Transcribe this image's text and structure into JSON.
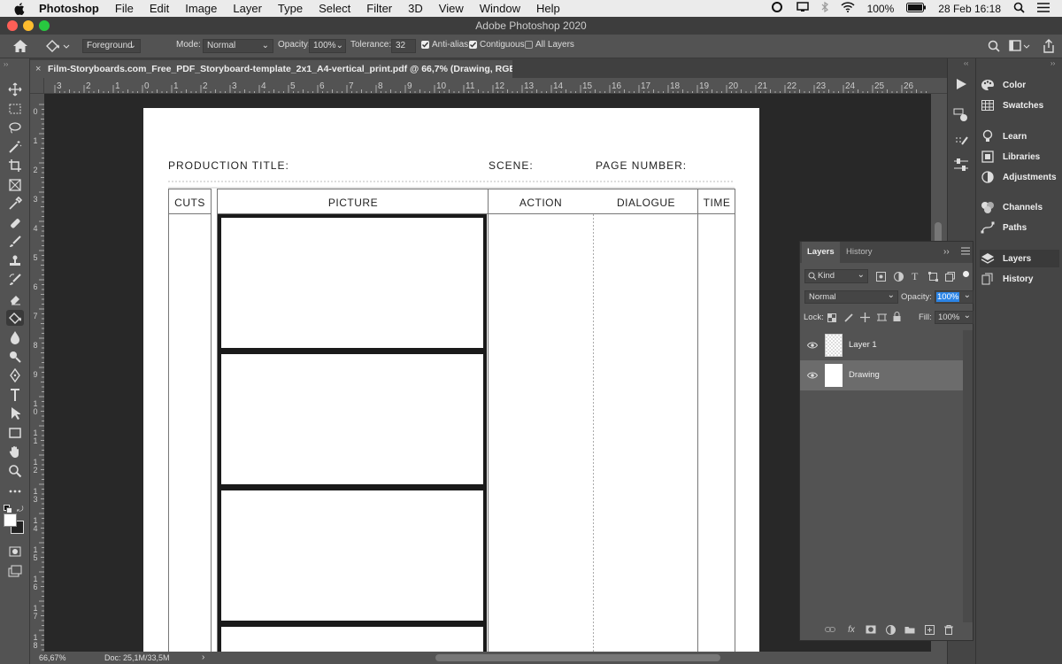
{
  "menubar": {
    "app": "Photoshop",
    "items": [
      "File",
      "Edit",
      "Image",
      "Layer",
      "Type",
      "Select",
      "Filter",
      "3D",
      "View",
      "Window",
      "Help"
    ],
    "battery": "100%",
    "datetime": "28 Feb  16:18"
  },
  "window": {
    "title": "Adobe Photoshop 2020"
  },
  "options": {
    "fill_source": "Foreground",
    "mode_label": "Mode:",
    "mode_value": "Normal",
    "opacity_label": "Opacity:",
    "opacity_value": "100%",
    "tolerance_label": "Tolerance:",
    "tolerance_value": "32",
    "antialias_label": "Anti-alias",
    "contiguous_label": "Contiguous",
    "all_layers_label": "All Layers"
  },
  "document": {
    "tab_title": "Film-Storyboards.com_Free_PDF_Storyboard-template_2x1_A4-vertical_print.pdf @ 66,7% (Drawing, RGB/8) *",
    "zoom": "66,67%",
    "doc_info": "Doc: 25,1M/33,5M"
  },
  "ruler": {
    "h": [
      "3",
      "2",
      "1",
      "0",
      "1",
      "2",
      "3",
      "4",
      "5",
      "6",
      "7",
      "8",
      "9",
      "10",
      "11",
      "12",
      "13",
      "14",
      "15",
      "16",
      "17",
      "18",
      "19",
      "20",
      "21",
      "22",
      "23",
      "24",
      "25",
      "26"
    ],
    "v": [
      "0",
      "1",
      "2",
      "3",
      "4",
      "5",
      "6",
      "7",
      "8",
      "9",
      "10",
      "11",
      "12",
      "13",
      "14",
      "15",
      "16",
      "17",
      "18"
    ]
  },
  "storyboard": {
    "production_title": "PRODUCTION TITLE:",
    "scene": "SCENE:",
    "page_number": "PAGE NUMBER:",
    "cols": [
      "CUTS",
      "PICTURE",
      "ACTION",
      "DIALOGUE",
      "TIME"
    ]
  },
  "panels": {
    "items": [
      "Color",
      "Swatches",
      "Learn",
      "Libraries",
      "Adjustments",
      "Channels",
      "Paths",
      "Layers",
      "History"
    ]
  },
  "layers_panel": {
    "tab_layers": "Layers",
    "tab_history": "History",
    "filter": "Kind",
    "blend_mode": "Normal",
    "opacity_label": "Opacity:",
    "opacity_value": "100%",
    "lock_label": "Lock:",
    "fill_label": "Fill:",
    "fill_value": "100%",
    "layers": [
      {
        "name": "Layer 1"
      },
      {
        "name": "Drawing"
      }
    ]
  },
  "colors": {
    "accent": "#2b84e6",
    "selected_layer": "#6c6c6c"
  }
}
